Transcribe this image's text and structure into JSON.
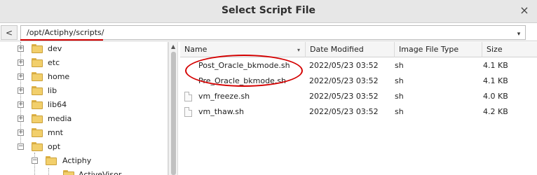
{
  "window": {
    "title": "Select Script File",
    "close_glyph": "×"
  },
  "pathbar": {
    "back_glyph": "<",
    "path": "/opt/Actiphy/scripts/",
    "dropdown_glyph": "▾"
  },
  "tree": {
    "items": [
      {
        "label": "dev",
        "expander": "+"
      },
      {
        "label": "etc",
        "expander": "+"
      },
      {
        "label": "home",
        "expander": "+"
      },
      {
        "label": "lib",
        "expander": "+"
      },
      {
        "label": "lib64",
        "expander": "+"
      },
      {
        "label": "media",
        "expander": "+"
      },
      {
        "label": "mnt",
        "expander": "+"
      },
      {
        "label": "opt",
        "expander": "−"
      },
      {
        "label": "Actiphy",
        "expander": "−"
      },
      {
        "label": "ActiveVisor",
        "expander": ""
      }
    ]
  },
  "filelist": {
    "columns": [
      "Name",
      "Date Modified",
      "Image File Type",
      "Size"
    ],
    "sort_glyph": "▾",
    "rows": [
      {
        "name": "Post_Oracle_bkmode.sh",
        "date": "2022/05/23 03:52",
        "type": "sh",
        "size": "4.1 KB"
      },
      {
        "name": "Pre_Oracle_bkmode.sh",
        "date": "2022/05/23 03:52",
        "type": "sh",
        "size": "4.1 KB"
      },
      {
        "name": "vm_freeze.sh",
        "date": "2022/05/23 03:52",
        "type": "sh",
        "size": "4.0 KB"
      },
      {
        "name": "vm_thaw.sh",
        "date": "2022/05/23 03:52",
        "type": "sh",
        "size": "4.2 KB"
      }
    ]
  },
  "colors": {
    "annotation_red": "#d40000",
    "folder_yellow": "#f2cf6b"
  }
}
